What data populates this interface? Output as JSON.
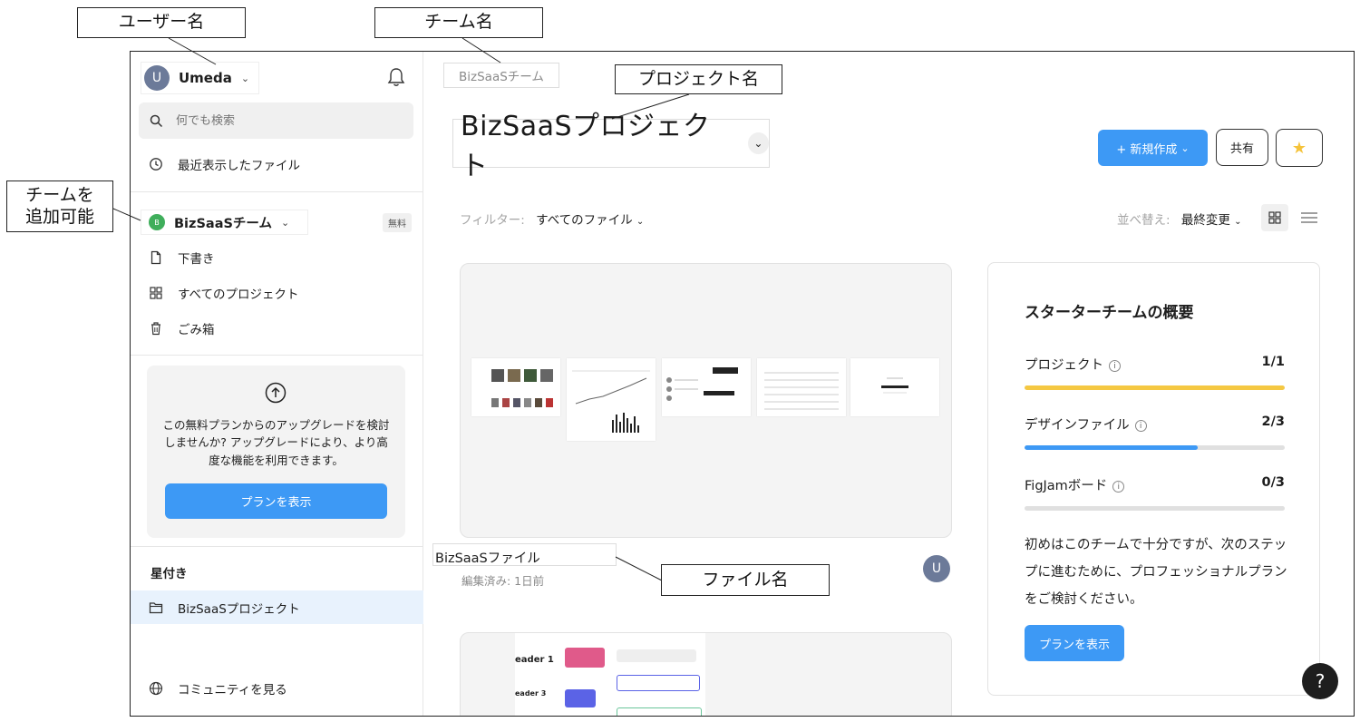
{
  "annotations": {
    "user_name": "ユーザー名",
    "team_name": "チーム名",
    "project_name": "プロジェクト名",
    "team_add_line1": "チームを",
    "team_add_line2": "追加可能",
    "file_name": "ファイル名"
  },
  "sidebar": {
    "user": {
      "initial": "U",
      "name": "Umeda"
    },
    "search_placeholder": "何でも検索",
    "recent": "最近表示したファイル",
    "team": {
      "initial": "B",
      "name": "BizSaaSチーム",
      "badge": "無料"
    },
    "items": [
      "下書き",
      "すべてのプロジェクト",
      "ごみ箱"
    ],
    "upgrade": {
      "text": "この無料プランからのアップグレードを検討しませんか? アップグレードにより、より高度な機能を利用できます。",
      "button": "プランを表示"
    },
    "starred_label": "星付き",
    "starred_item": "BizSaaSプロジェクト",
    "community": "コミュニティを見る"
  },
  "main": {
    "team_breadcrumb": "BizSaaSチーム",
    "project_title": "BizSaaSプロジェクト",
    "new_button": "+ 新規作成",
    "share_button": "共有",
    "filter_label": "フィルター:",
    "filter_value": "すべてのファイル",
    "sort_label": "並べ替え:",
    "sort_value": "最終変更",
    "file": {
      "name": "BizSaaSファイル",
      "edited": "編集済み: 1日前",
      "avatar": "U"
    },
    "second_file_preview_text": [
      "eader 1",
      "eader 3"
    ]
  },
  "overview": {
    "title": "スターターチームの概要",
    "rows": [
      {
        "label": "プロジェクト",
        "value": "1/1",
        "fraction": 1.0,
        "color": "#f5c842"
      },
      {
        "label": "デザインファイル",
        "value": "2/3",
        "fraction": 0.667,
        "color": "#3d99f5"
      },
      {
        "label": "FigJamボード",
        "value": "0/3",
        "fraction": 0.0,
        "color": "#3d99f5"
      }
    ],
    "info_icon": "i",
    "text": "初めはこのチームで十分ですが、次のステップに進むために、プロフェッショナルプランをご検討ください。",
    "button": "プランを表示"
  },
  "help": "?",
  "colors": {
    "accent": "#3d99f5",
    "star": "#f5c33b",
    "selected": "#e8f2fd"
  }
}
